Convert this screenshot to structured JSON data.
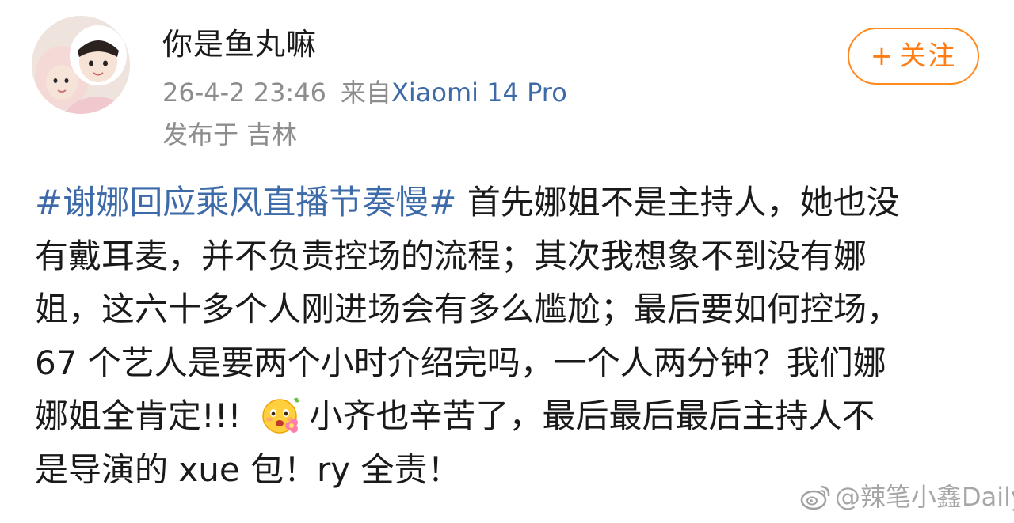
{
  "post": {
    "author": {
      "name": "你是鱼丸嘛",
      "avatar_icon": "avatar-image"
    },
    "timestamp": "26-4-2 23:46",
    "source_prefix": "来自",
    "device": "Xiaomi 14 Pro",
    "location": "发布于 吉林",
    "follow_button": {
      "icon": "plus-icon",
      "plus": "+",
      "label": "关注"
    },
    "body": {
      "topic": "#谢娜回应乘风直播节奏慢#",
      "line1_rest": " 首先娜姐不是主持人，她也没",
      "line2": "有戴耳麦，并不负责控场的流程；其次我想象不到没有娜",
      "line3": "姐，这六十多个人刚进场会有多么尴尬；最后要如何控场，",
      "line4": "67 个艺人是要两个小时介绍完吗，一个人两分钟？我们娜",
      "line5_before": "娜姐全肯定!!!",
      "emoji_icon": "flower-smile-emoji",
      "line5_after": "小齐也辛苦了，最后最后最后主持人不",
      "line6": "是导演的 xue 包！ry 全责！"
    }
  },
  "watermark": {
    "icon": "weibo-logo-icon",
    "text": "@辣笔小鑫Daily"
  },
  "colors": {
    "link": "#3d6aa8",
    "follow_accent": "#ff8a1f",
    "meta_gray": "#8d8d8d",
    "text": "#1a1a1a"
  }
}
